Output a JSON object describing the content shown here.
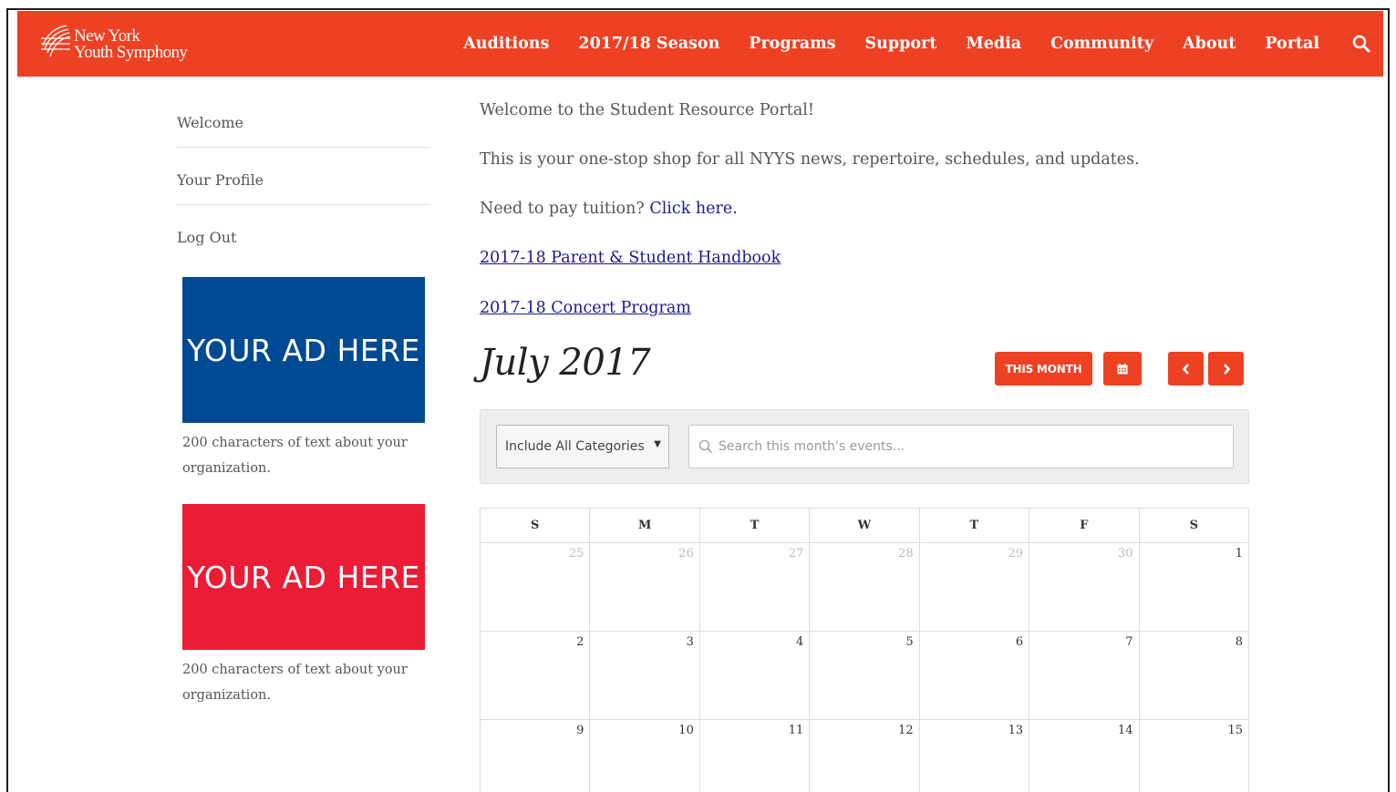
{
  "colors": {
    "brand": "#ee4123",
    "ad_blue": "#004a93",
    "ad_red": "#ec1b36",
    "link": "#1a1a8c"
  },
  "header": {
    "logo_line1": "New York",
    "logo_line2": "Youth Symphony",
    "nav": [
      "Auditions",
      "2017/18 Season",
      "Programs",
      "Support",
      "Media",
      "Community",
      "About",
      "Portal"
    ],
    "search_icon": "search-icon"
  },
  "sidebar": {
    "links": [
      "Welcome",
      "Your Profile",
      "Log Out"
    ],
    "ads": [
      {
        "label": "YOUR AD HERE",
        "text": "200 characters of text about your organization."
      },
      {
        "label": "YOUR AD HERE",
        "text": "200 characters of text about your organization."
      }
    ]
  },
  "main": {
    "welcome": "Welcome to the Student Resource Portal!",
    "intro": "This is your one-stop shop for all NYYS news, repertoire, schedules, and updates.",
    "tuition_prefix": "Need to pay tuition?",
    "tuition_link": "Click here.",
    "handbook_link": "2017-18 Parent & Student Handbook",
    "program_link": "2017-18 Concert Program "
  },
  "calendar": {
    "month_title": "July 2017",
    "this_month_label": "THIS MONTH",
    "calendar_icon": "calendar-icon",
    "prev_icon": "chevron-left-icon",
    "next_icon": "chevron-right-icon",
    "category_select": "Include All Categories",
    "search_placeholder": "Search this month's events...",
    "weekdays": [
      "S",
      "M",
      "T",
      "W",
      "T",
      "F",
      "S"
    ],
    "weeks": [
      [
        {
          "d": "25",
          "other": true
        },
        {
          "d": "26",
          "other": true
        },
        {
          "d": "27",
          "other": true
        },
        {
          "d": "28",
          "other": true
        },
        {
          "d": "29",
          "other": true
        },
        {
          "d": "30",
          "other": true
        },
        {
          "d": "1",
          "other": false
        }
      ],
      [
        {
          "d": "2",
          "other": false
        },
        {
          "d": "3",
          "other": false
        },
        {
          "d": "4",
          "other": false
        },
        {
          "d": "5",
          "other": false
        },
        {
          "d": "6",
          "other": false
        },
        {
          "d": "7",
          "other": false
        },
        {
          "d": "8",
          "other": false
        }
      ],
      [
        {
          "d": "9",
          "other": false
        },
        {
          "d": "10",
          "other": false
        },
        {
          "d": "11",
          "other": false
        },
        {
          "d": "12",
          "other": false
        },
        {
          "d": "13",
          "other": false
        },
        {
          "d": "14",
          "other": false
        },
        {
          "d": "15",
          "other": false
        }
      ]
    ]
  }
}
